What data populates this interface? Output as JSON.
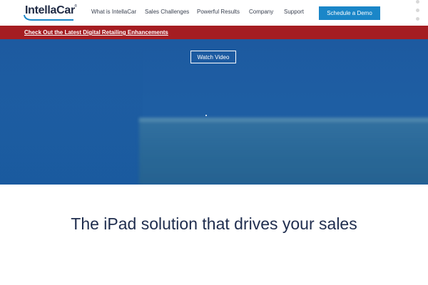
{
  "brand": {
    "logo_text": "IntellaCar",
    "logo_mark": "®",
    "colors": {
      "navy": "#1f2a44",
      "accent": "#1a86c8",
      "promo": "#a51d22",
      "hero": "#1d5aa0"
    }
  },
  "nav": {
    "items": [
      {
        "label": "What is IntellaCar"
      },
      {
        "label": "Sales Challenges"
      },
      {
        "label": "Powerful Results"
      },
      {
        "label": "Company"
      },
      {
        "label": "Support"
      }
    ],
    "cta_label": "Schedule a Demo"
  },
  "promo": {
    "link_text": "Check Out the Latest Digital Retailing Enhancements"
  },
  "hero": {
    "watch_video_label": "Watch Video"
  },
  "section_nav": {
    "dot_count": 5,
    "active_index": 4
  },
  "main": {
    "tagline": "The iPad solution that drives your sales"
  }
}
